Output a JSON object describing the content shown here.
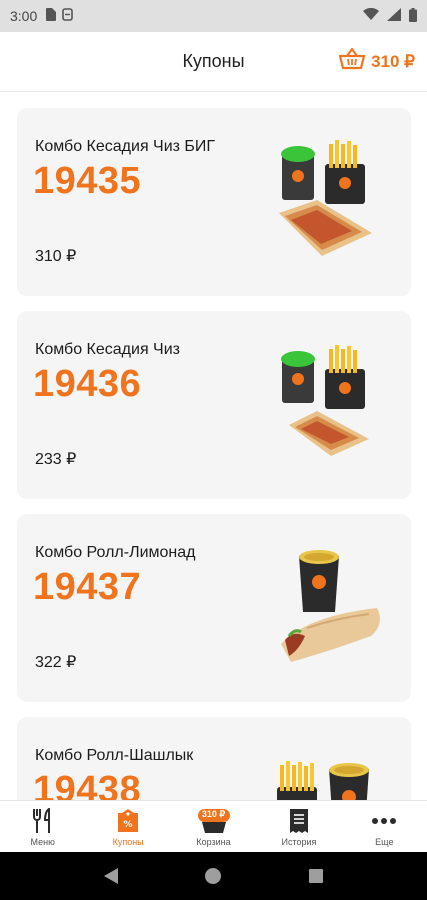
{
  "status_bar": {
    "time": "3:00"
  },
  "header": {
    "title": "Купоны",
    "cart_total": "310 ₽"
  },
  "coupons": [
    {
      "name": "Комбо Кесадия Чиз БИГ",
      "code": "19435",
      "price": "310 ₽"
    },
    {
      "name": "Комбо Кесадия Чиз",
      "code": "19436",
      "price": "233 ₽"
    },
    {
      "name": "Комбо Ролл-Лимонад",
      "code": "19437",
      "price": "322 ₽"
    },
    {
      "name": "Комбо Ролл-Шашлык",
      "code": "19438",
      "price": ""
    }
  ],
  "bottom_nav": {
    "menu": "Меню",
    "coupons": "Купоны",
    "cart": "Корзина",
    "cart_badge": "310 ₽",
    "history": "История",
    "more": "Еще"
  },
  "colors": {
    "accent": "#f0731e",
    "card_bg": "#f5f5f5"
  }
}
